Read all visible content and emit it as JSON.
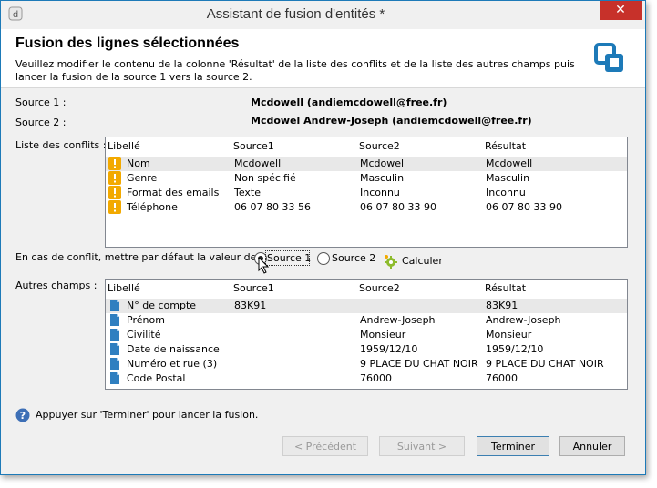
{
  "window": {
    "title": "Assistant de fusion d'entités *",
    "close_glyph": "✕"
  },
  "header": {
    "title": "Fusion des lignes sélectionnées",
    "description": "Veuillez modifier le contenu de la colonne 'Résultat' de la liste des conflits et de la liste des autres champs puis lancer la fusion de la source 1 vers la source 2.",
    "icon": "merge-icon"
  },
  "sources": {
    "source1_label": "Source 1 :",
    "source1_value": "Mcdowell  (andiemcdowell@free.fr)",
    "source2_label": "Source 2 :",
    "source2_value": "Mcdowel Andrew-Joseph (andiemcdowell@free.fr)"
  },
  "conflicts": {
    "label": "Liste des conflits :",
    "columns": [
      "Libellé",
      "Source1",
      "Source2",
      "Résultat"
    ],
    "row_icon": "warning-icon",
    "rows": [
      {
        "label": "Nom",
        "source1": "Mcdowell",
        "source2": "Mcdowel",
        "result": "Mcdowell"
      },
      {
        "label": "Genre",
        "source1": "Non spécifié",
        "source2": "Masculin",
        "result": "Masculin"
      },
      {
        "label": "Format des emails",
        "source1": "Texte",
        "source2": "Inconnu",
        "result": "Inconnu"
      },
      {
        "label": "Téléphone",
        "source1": "06 07 80 33 56",
        "source2": "06 07 80 33 90",
        "result": "06 07 80 33 90"
      }
    ]
  },
  "default_choice": {
    "label": "En cas de conflit, mettre par défaut la valeur de :",
    "option1": "Source 1",
    "option2": "Source 2",
    "selected": "Source 1",
    "calculate_label": "Calculer"
  },
  "other_fields": {
    "label": "Autres champs :",
    "columns": [
      "Libellé",
      "Source1",
      "Source2",
      "Résultat"
    ],
    "row_icon": "field-icon",
    "rows": [
      {
        "label": "N° de compte",
        "source1": "83K91",
        "source2": "",
        "result": "83K91"
      },
      {
        "label": "Prénom",
        "source1": "",
        "source2": "Andrew-Joseph",
        "result": "Andrew-Joseph"
      },
      {
        "label": "Civilité",
        "source1": "",
        "source2": "Monsieur",
        "result": "Monsieur"
      },
      {
        "label": "Date de naissance",
        "source1": "",
        "source2": "1959/12/10",
        "result": "1959/12/10"
      },
      {
        "label": "Numéro et rue (3)",
        "source1": "",
        "source2": "9 PLACE DU CHAT NOIR",
        "result": "9 PLACE DU CHAT NOIR"
      },
      {
        "label": "Code Postal",
        "source1": "",
        "source2": "76000",
        "result": "76000"
      }
    ]
  },
  "hint": {
    "text": "Appuyer sur 'Terminer' pour lancer la fusion.",
    "icon": "help-icon"
  },
  "buttons": {
    "previous": "< Précédent",
    "next": "Suivant >",
    "finish": "Terminer",
    "cancel": "Annuler"
  },
  "colors": {
    "accent": "#1d7ab8",
    "warning": "#f2a900",
    "field_icon": "#2f7fc0",
    "close": "#c7312a"
  }
}
